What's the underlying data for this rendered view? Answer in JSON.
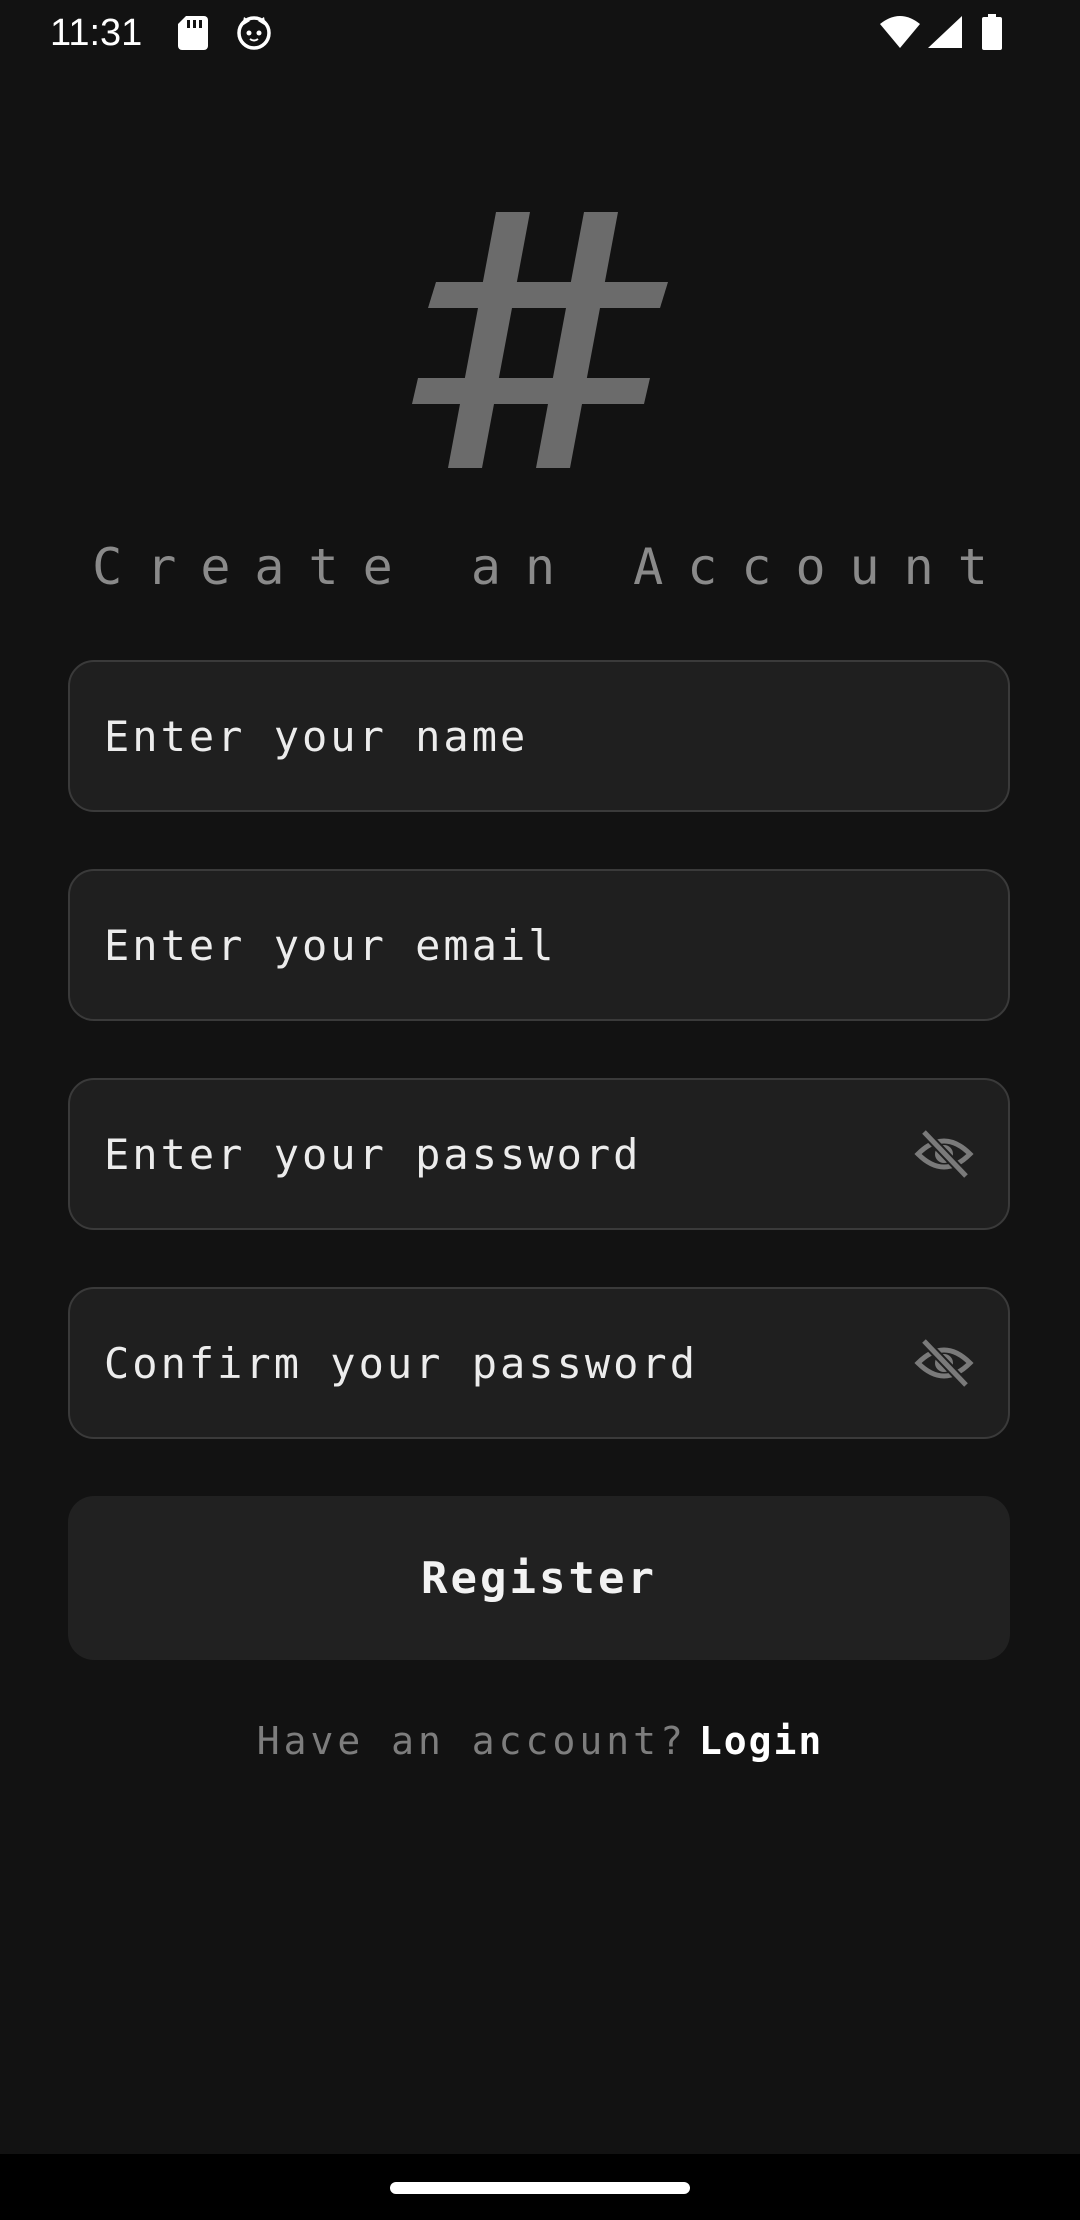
{
  "status_bar": {
    "time": "11:31",
    "icons": [
      "sd-card-icon",
      "cat-face-icon",
      "wifi-icon",
      "cellular-signal-icon",
      "battery-icon"
    ]
  },
  "logo": {
    "glyph": "#",
    "color": "#6b6b6b"
  },
  "title": "Create an Account",
  "form": {
    "name_placeholder": "Enter your name",
    "email_placeholder": "Enter your email",
    "password_placeholder": "Enter your password",
    "confirm_placeholder": "Confirm your password",
    "password_toggle_icon": "eye-off-icon",
    "register_label": "Register"
  },
  "footer": {
    "prompt": "Have an account?",
    "login_label": "Login"
  },
  "colors": {
    "background": "#121212",
    "field_background": "#1f1f1f",
    "field_border": "#3a3a3a",
    "title": "#8a8a8a",
    "muted_text": "#7d7d7d"
  }
}
